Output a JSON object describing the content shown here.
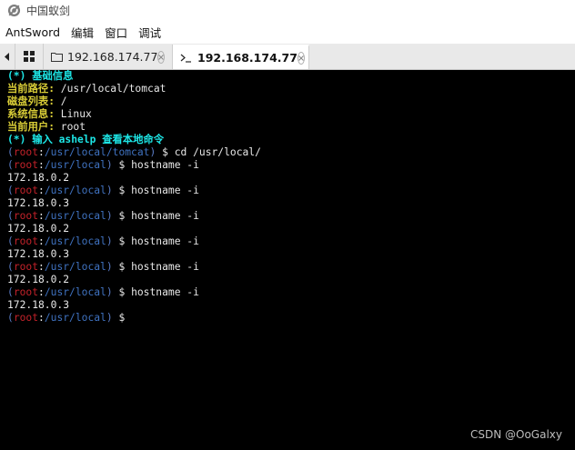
{
  "window": {
    "title": "中国蚁剑"
  },
  "menu": {
    "items": [
      "AntSword",
      "编辑",
      "窗口",
      "调试"
    ]
  },
  "tabs": [
    {
      "label": "192.168.174.77",
      "icon": "folder-icon",
      "active": false
    },
    {
      "label": "192.168.174.77",
      "icon": "terminal-icon",
      "active": true
    }
  ],
  "terminal": {
    "info": {
      "header": "(*) 基础信息",
      "path_label": "当前路径:",
      "path_value": " /usr/local/tomcat",
      "disk_label": "磁盘列表:",
      "disk_value": " /",
      "sys_label": "系统信息:",
      "sys_value": " Linux",
      "user_label": "当前用户:",
      "user_value": " root",
      "help": "(*) 输入 ashelp 查看本地命令"
    },
    "prompt_user": "root",
    "prompt_dollar": " $",
    "lines": [
      {
        "type": "prompt",
        "path": "/usr/local/tomcat",
        "cmd": " cd /usr/local/"
      },
      {
        "type": "prompt",
        "path": "/usr/local",
        "cmd": " hostname -i"
      },
      {
        "type": "output",
        "text": "172.18.0.2"
      },
      {
        "type": "prompt",
        "path": "/usr/local",
        "cmd": " hostname -i"
      },
      {
        "type": "output",
        "text": "172.18.0.3"
      },
      {
        "type": "prompt",
        "path": "/usr/local",
        "cmd": " hostname -i"
      },
      {
        "type": "output",
        "text": "172.18.0.2"
      },
      {
        "type": "prompt",
        "path": "/usr/local",
        "cmd": " hostname -i"
      },
      {
        "type": "output",
        "text": "172.18.0.3"
      },
      {
        "type": "prompt",
        "path": "/usr/local",
        "cmd": " hostname -i"
      },
      {
        "type": "output",
        "text": "172.18.0.2"
      },
      {
        "type": "prompt",
        "path": "/usr/local",
        "cmd": " hostname -i"
      },
      {
        "type": "output",
        "text": "172.18.0.3"
      },
      {
        "type": "prompt",
        "path": "/usr/local",
        "cmd": ""
      }
    ]
  },
  "watermark": "CSDN @OoGalxy",
  "colors": {
    "cyan": "#1de6e6",
    "yellow": "#d8cc37",
    "user_red": "#c4222a",
    "path_blue": "#3f72c0"
  }
}
